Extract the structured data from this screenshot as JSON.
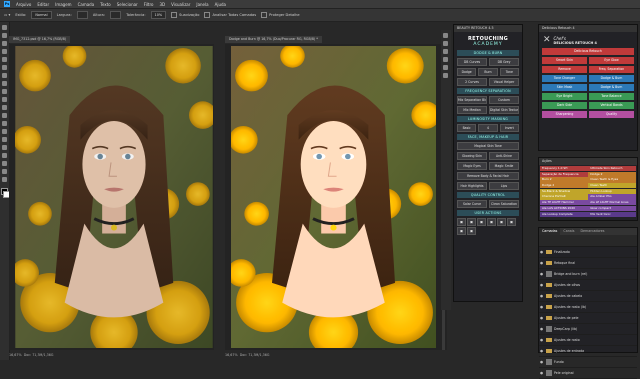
{
  "app": {
    "logo": "Ps"
  },
  "menu": [
    "Arquivo",
    "Editar",
    "Imagem",
    "Camada",
    "Texto",
    "Selecionar",
    "Filtro",
    "3D",
    "Visualizar",
    "Janela",
    "Ajuda"
  ],
  "options": {
    "estilo_label": "Estilo:",
    "estilo_value": "Normal",
    "largura_label": "Largura:",
    "altura_label": "Altura:",
    "refinar_label": "Selecionar e Aplicar Máscara...",
    "tolerancia_label": "Tolerância:",
    "tolerancia_value": "10%",
    "suavizacao_label": "Suavização",
    "todas_camadas_label": "Analisar Todas Camadas",
    "proteger_label": "Proteger Detalhe"
  },
  "documents": {
    "left": {
      "tab": "IMG_7312.psd @ 16,7% (RGB/8)",
      "status": "16,67%",
      "status_doc": "Doc: 71,3M/1,36G"
    },
    "right": {
      "tab": "Dodge and Burn @ 16,7% (Duo/Procurar RG, RGB/8) *",
      "status": "16,67%",
      "status_doc": "Doc: 71,3M/1,36G"
    }
  },
  "beauty_panel": {
    "title": "BEAUTY RETOUCH 4.5",
    "brand_top": "RETOUCHING",
    "brand_bottom": "ACADEMY",
    "sections": [
      {
        "title": "DODGE & BURN",
        "rows": [
          [
            "DB Curves",
            "DB Grey"
          ],
          [
            "Dodge",
            "Burn",
            "Tone"
          ],
          [
            "2 Curves",
            "Visual Helper"
          ]
        ]
      },
      {
        "title": "FREQUENCY SEPARATION",
        "rows": [
          [
            "Mix Separation Blur",
            "Custom"
          ],
          [
            "Mix Median",
            "Digital Skin Texture"
          ]
        ]
      },
      {
        "title": "LUMINOSITY MASKING",
        "rows": [
          [
            "Basic",
            "4",
            "Invert"
          ]
        ]
      },
      {
        "title": "FACE, MAKEUP & HAIR",
        "rows": [
          [
            "Magical Skin Tone"
          ],
          [
            "Glowing Skin",
            "Anti-Shine"
          ],
          [
            "Magic Eyes",
            "Magic Smile"
          ],
          [
            "Remove Body & Facial Hair"
          ],
          [
            "Hair Highlights",
            "Lips"
          ]
        ]
      },
      {
        "title": "QUALITY CONTROL",
        "rows": [
          [
            "Solar Curve",
            "Clean Saturation"
          ]
        ]
      },
      {
        "title": "USER ACTIONS",
        "rows": []
      }
    ]
  },
  "delicious_panel": {
    "title": "Delicious Retouch 4",
    "brand_top": "Chef's",
    "brand_bottom": "DELICIOUS RETOUCH 4",
    "buttons": [
      [
        {
          "label": "Delicious Retouch",
          "color": "#c03a3a"
        }
      ],
      [
        {
          "label": "Smart Skin",
          "color": "#c03a3a"
        },
        {
          "label": "Eye Glow",
          "color": "#c03a3a"
        }
      ],
      [
        {
          "label": "Remove",
          "color": "#c03a3a"
        },
        {
          "label": "Freq. Separation",
          "color": "#c03a3a"
        }
      ],
      [
        {
          "label": "Tone Changer",
          "color": "#2c79b8"
        },
        {
          "label": "Dodge & Burn",
          "color": "#2c79b8"
        }
      ],
      [
        {
          "label": "Skin Mask",
          "color": "#2c79b8"
        },
        {
          "label": "Dodge & Burn",
          "color": "#2c79b8"
        }
      ],
      [
        {
          "label": "Eye Bright",
          "color": "#3a9a55"
        },
        {
          "label": "Tone Balance",
          "color": "#3a9a55"
        }
      ],
      [
        {
          "label": "Dark Side",
          "color": "#3a9a55"
        },
        {
          "label": "Vertical Bands",
          "color": "#3a9a55"
        }
      ],
      [
        {
          "label": "Sharpening",
          "color": "#b34fa0"
        },
        {
          "label": "Quality",
          "color": "#b34fa0"
        }
      ]
    ]
  },
  "actions_panel": {
    "title": "Ações",
    "items": [
      {
        "label": "Frequency 1.0 SH",
        "color": "#b03c3c"
      },
      {
        "label": "Ultimate Skin Retouch",
        "color": "#b03c3c"
      },
      {
        "label": "Separação de Frequencia",
        "color": "#b03c3c"
      },
      {
        "label": "Dodge 2",
        "color": "#c07a2a"
      },
      {
        "label": "Burn 2",
        "color": "#c07a2a"
      },
      {
        "label": "Clean Teeth & Eyes",
        "color": "#c07a2a"
      },
      {
        "label": "Dodge 2",
        "color": "#c07a2a"
      },
      {
        "label": "Clean Teeth",
        "color": "#c0a52a"
      },
      {
        "label": "SA-Black & Shadow",
        "color": "#c0a52a"
      },
      {
        "label": "Hidden Lookup",
        "color": "#c0a52a"
      },
      {
        "label": "Cherone Portrait",
        "color": "#c0a52a"
      },
      {
        "label": "Ale Ambar Pho",
        "color": "#7a4aa0"
      },
      {
        "label": "Ale TP LIGHT Hammel",
        "color": "#7a4aa0"
      },
      {
        "label": "Ale LP LIGHT Normal Lines",
        "color": "#7a4aa0"
      },
      {
        "label": "Ale LAS ACTIONS 2020",
        "color": "#7a4aa0"
      },
      {
        "label": "Glow compact",
        "color": "#7a4aa0"
      },
      {
        "label": "Ale Lookup Complete",
        "color": "#5a3a8a"
      },
      {
        "label": "Mix Vent tonic",
        "color": "#5a3a8a"
      }
    ]
  },
  "layers_panel": {
    "tabs": [
      "Camadas",
      "Canais",
      "Demarcadores"
    ],
    "items": [
      {
        "name": "Finalizado",
        "type": "folder"
      },
      {
        "name": "Retoque final",
        "type": "folder"
      },
      {
        "name": "Bridge and burn (rel)",
        "type": "layer"
      },
      {
        "name": "Ajustes de olhos",
        "type": "folder"
      },
      {
        "name": "Ajustes de cabelo",
        "type": "folder"
      },
      {
        "name": "Ajustes de rosto (lb)",
        "type": "folder"
      },
      {
        "name": "Ajustes de pele",
        "type": "folder"
      },
      {
        "name": "DeepCarp (lib)",
        "type": "layer"
      },
      {
        "name": "Ajustes de rosto",
        "type": "folder"
      },
      {
        "name": "Ajustes de entrada",
        "type": "folder"
      },
      {
        "name": "Fundo",
        "type": "layer"
      },
      {
        "name": "Pele original",
        "type": "layer"
      }
    ]
  },
  "colors": {
    "accent": "#31a8ff",
    "section": "#2c4d58",
    "panel_bg": "#222226"
  }
}
